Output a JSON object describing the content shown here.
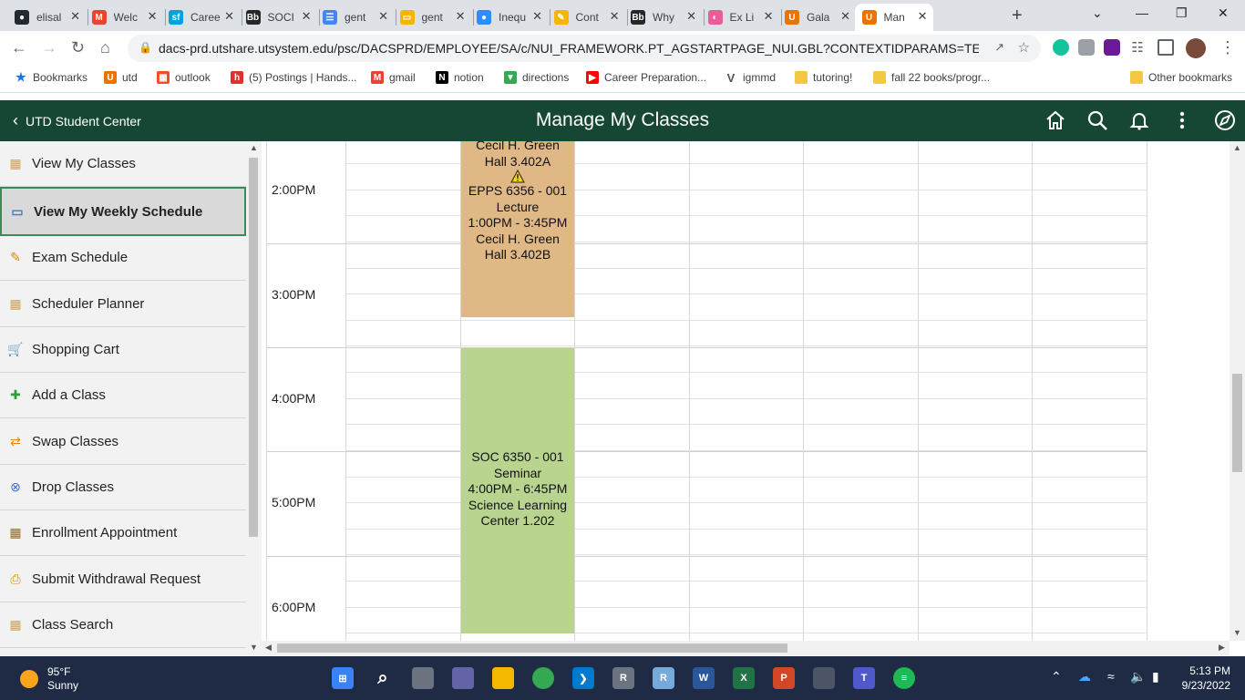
{
  "browser": {
    "tabs": [
      {
        "title": "elisal",
        "icon": "github-icon",
        "color": "#24292f"
      },
      {
        "title": "Welc",
        "icon": "gmail-icon",
        "color": "#ea4335"
      },
      {
        "title": "Caree",
        "icon": "salesforce-icon",
        "color": "#00a1e0"
      },
      {
        "title": "SOCI",
        "icon": "blackboard-icon",
        "color": "#262626"
      },
      {
        "title": "gent",
        "icon": "google-docs-icon",
        "color": "#4285f4"
      },
      {
        "title": "gent",
        "icon": "google-slides-icon",
        "color": "#f4b400"
      },
      {
        "title": "Inequ",
        "icon": "zoom-like-icon",
        "color": "#2d8cff"
      },
      {
        "title": "Cont",
        "icon": "pencil-icon",
        "color": "#f7b500"
      },
      {
        "title": "Why",
        "icon": "blackboard-icon",
        "color": "#262626"
      },
      {
        "title": "Ex Li",
        "icon": "rainbow-icon",
        "color": "#e85d9a"
      },
      {
        "title": "Gala",
        "icon": "utd-icon",
        "color": "#e87500"
      },
      {
        "title": "Man",
        "icon": "utd-icon",
        "color": "#e87500",
        "active": true
      }
    ],
    "url": "dacs-prd.utshare.utsystem.edu/psc/DACSPRD/EMPLOYEE/SA/c/NUI_FRAMEWORK.PT_AGSTARTPAGE_NUI.GBL?CONTEXTIDPARAMS=TEMPLATE_...",
    "bookmarks": [
      {
        "label": "Bookmarks",
        "icon": "star-icon",
        "color": "#1a73e8"
      },
      {
        "label": "utd",
        "icon": "utd-icon",
        "color": "#e87500"
      },
      {
        "label": "outlook",
        "icon": "microsoft-icon",
        "color": "#f25022"
      },
      {
        "label": "(5) Postings | Hands...",
        "icon": "handshake-icon",
        "color": "#e0312f"
      },
      {
        "label": "gmail",
        "icon": "gmail-icon",
        "color": "#ea4335"
      },
      {
        "label": "notion",
        "icon": "notion-icon",
        "color": "#000000"
      },
      {
        "label": "directions",
        "icon": "maps-pin-icon",
        "color": "#34a853"
      },
      {
        "label": "Career Preparation...",
        "icon": "youtube-icon",
        "color": "#ff0000"
      },
      {
        "label": "igmmd",
        "icon": "v-icon",
        "color": "#555555"
      },
      {
        "label": "tutoring!",
        "icon": "folder-icon",
        "color": "#f5c842"
      },
      {
        "label": "fall 22 books/progr...",
        "icon": "folder-icon",
        "color": "#f5c842"
      }
    ],
    "other_bookmarks": "Other bookmarks"
  },
  "header": {
    "back_label": "UTD Student Center",
    "title": "Manage My Classes",
    "bg_color": "#154734"
  },
  "sidebar": {
    "items": [
      {
        "label": "View My Classes",
        "icon": "calendar-list-icon"
      },
      {
        "label": "View My Weekly Schedule",
        "icon": "calendar-icon",
        "active": true
      },
      {
        "label": "Exam Schedule",
        "icon": "exam-edit-icon"
      },
      {
        "label": "Scheduler Planner",
        "icon": "planner-calendar-icon"
      },
      {
        "label": "Shopping Cart",
        "icon": "shopping-cart-icon"
      },
      {
        "label": "Add a Class",
        "icon": "plus-icon"
      },
      {
        "label": "Swap Classes",
        "icon": "swap-icon"
      },
      {
        "label": "Drop Classes",
        "icon": "x-circle-icon"
      },
      {
        "label": "Enrollment Appointment",
        "icon": "appointment-calendar-icon"
      },
      {
        "label": "Submit Withdrawal Request",
        "icon": "withdraw-document-icon"
      },
      {
        "label": "Class Search",
        "icon": "search-calendar-icon"
      }
    ]
  },
  "schedule": {
    "times": [
      "2:00PM",
      "3:00PM",
      "4:00PM",
      "5:00PM",
      "6:00PM"
    ],
    "blocks": [
      {
        "lines_top": [
          "Cecil H. Green",
          "Hall 3.402A"
        ],
        "warning": true,
        "lines": [
          "EPPS 6356 - 001",
          "Lecture",
          "1:00PM - 3:45PM",
          "Cecil H. Green",
          "Hall 3.402B"
        ],
        "color": "#dfb886"
      },
      {
        "lines": [
          "SOC 6350 - 001",
          "Seminar",
          "4:00PM - 6:45PM",
          "Science Learning",
          "Center 1.202"
        ],
        "color": "#b8d48f"
      }
    ]
  },
  "taskbar": {
    "temp": "95°F",
    "condition": "Sunny",
    "time": "5:13 PM",
    "date": "9/23/2022"
  }
}
